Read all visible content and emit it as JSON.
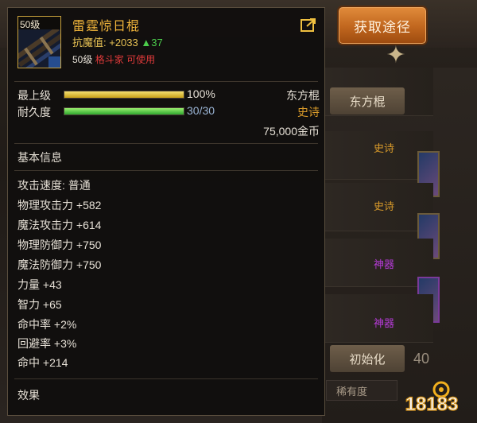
{
  "background": {
    "get_path_button": "获取途径",
    "tab_button": "东方棍",
    "tags": [
      {
        "text": "史诗",
        "color": "#d89a2a"
      },
      {
        "text": "史诗",
        "color": "#d89a2a"
      },
      {
        "text": "神器",
        "color": "#b43bd6"
      },
      {
        "text": "神器",
        "color": "#b43bd6"
      }
    ],
    "init_button": "初始化",
    "select_label": "稀有度",
    "partial_number": "40"
  },
  "tooltip": {
    "icon_level": "50级",
    "item_name": "雷霆惊日棍",
    "resist_label": "抗魔值: +2033",
    "resist_delta": "▲37",
    "req_level": "50级",
    "req_class": "格斗家",
    "req_status": "可使用",
    "upgrade_label": "最上级",
    "upgrade_value": "100%",
    "upgrade_fraction": 1.0,
    "durability_label": "耐久度",
    "durability_value": "30/30",
    "durability_fraction": 1.0,
    "weapon_type": "东方棍",
    "rarity": "史诗",
    "price": "75,000金币",
    "section_basic": "基本信息",
    "stats": [
      "攻击速度: 普通",
      "物理攻击力 +582",
      "魔法攻击力 +614",
      "物理防御力 +750",
      "魔法防御力 +750",
      "力量 +43",
      "智力 +65",
      "命中率 +2%",
      "回避率 +3%",
      "命中 +214"
    ],
    "section_effect": "效果"
  },
  "colors": {
    "gold_text": "#f0b43a",
    "rarity_epic": "#d89a2a",
    "rarity_artifact": "#b43bd6",
    "positive_green": "#4ccd4c",
    "class_red": "#e03a3a"
  },
  "watermark": "18183"
}
